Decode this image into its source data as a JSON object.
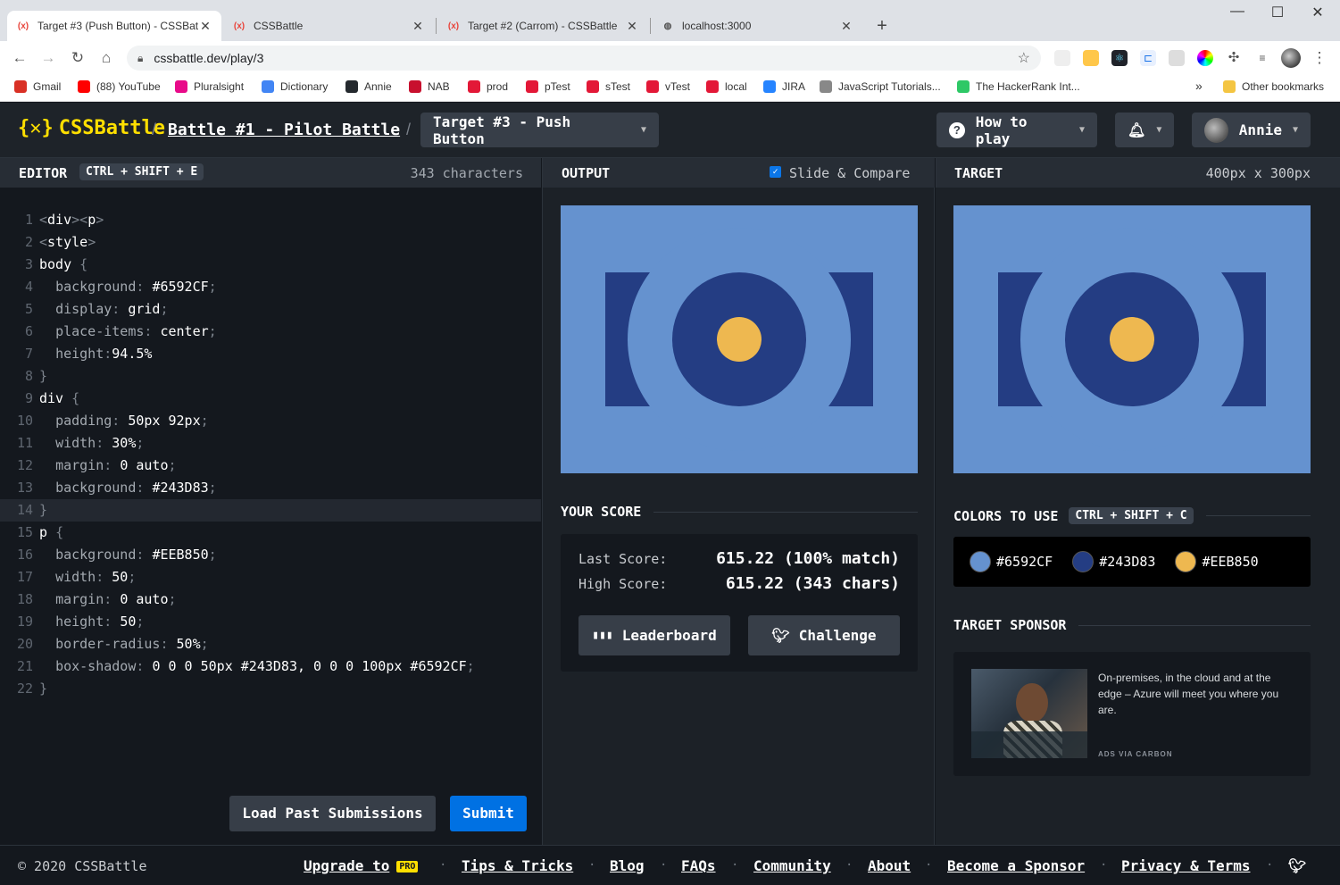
{
  "browser": {
    "tabs": [
      {
        "title": "Target #3 (Push Button) - CSSBat",
        "favicon": "cssbattle-favicon",
        "active": true
      },
      {
        "title": "CSSBattle",
        "favicon": "cssbattle-favicon",
        "active": false
      },
      {
        "title": "Target #2 (Carrom) - CSSBattle",
        "favicon": "cssbattle-favicon",
        "active": false
      },
      {
        "title": "localhost:3000",
        "favicon": "globe-icon",
        "active": false
      }
    ],
    "url": "cssbattle.dev/play/3",
    "bookmarks": [
      {
        "label": "Gmail",
        "color": "#d93025"
      },
      {
        "label": "(88) YouTube",
        "color": "#ff0000"
      },
      {
        "label": "Pluralsight",
        "color": "#e80a89"
      },
      {
        "label": "Dictionary",
        "color": "#4285f4"
      },
      {
        "label": "Annie",
        "color": "#24292e"
      },
      {
        "label": "NAB",
        "color": "#c8102e"
      },
      {
        "label": "prod",
        "color": "#e31837"
      },
      {
        "label": "pTest",
        "color": "#e31837"
      },
      {
        "label": "sTest",
        "color": "#e31837"
      },
      {
        "label": "vTest",
        "color": "#e31837"
      },
      {
        "label": "local",
        "color": "#e31837"
      },
      {
        "label": "JIRA",
        "color": "#2684ff"
      },
      {
        "label": "JavaScript Tutorials...",
        "color": "#888888"
      },
      {
        "label": "The HackerRank Int...",
        "color": "#2ec866"
      }
    ],
    "more_bookmarks": "»",
    "other_bookmarks": "Other bookmarks"
  },
  "header": {
    "logo_text": "CSSBattle",
    "battle_link": "Battle #1 - Pilot Battle",
    "target_select": "Target #3 - Push Button",
    "how_to_play": "How to play",
    "user_name": "Annie"
  },
  "editor": {
    "label": "EDITOR",
    "shortcut": "CTRL + SHIFT + E",
    "char_count": "343 characters",
    "lines": [
      "<div><p>",
      "<style>",
      "body {",
      "  background: #6592CF;",
      "  display: grid;",
      "  place-items: center;",
      "  height:94.5%",
      "}",
      "div {",
      "  padding: 50px 92px;",
      "  width: 30%;",
      "  margin: 0 auto;",
      "  background: #243D83;",
      "}",
      "p {",
      "  background: #EEB850;",
      "  width: 50;",
      "  margin: 0 auto;",
      "  height: 50;",
      "  border-radius: 50%;",
      "  box-shadow: 0 0 0 50px #243D83, 0 0 0 100px #6592CF;",
      "}"
    ],
    "load_past_label": "Load Past Submissions",
    "submit_label": "Submit"
  },
  "output": {
    "label": "OUTPUT",
    "slide_compare_label": "Slide & Compare",
    "slide_compare_checked": true,
    "score_title": "YOUR SCORE",
    "last_score_label": "Last Score:",
    "last_score_value": "615.22 (100% match)",
    "high_score_label": "High Score:",
    "high_score_value": "615.22 (343 chars)",
    "leaderboard_label": "Leaderboard",
    "challenge_label": "Challenge"
  },
  "target": {
    "label": "TARGET",
    "dimensions": "400px x 300px",
    "colors_title": "COLORS TO USE",
    "colors_shortcut": "CTRL + SHIFT + C",
    "colors": [
      "#6592CF",
      "#243D83",
      "#EEB850"
    ],
    "sponsor_title": "TARGET SPONSOR",
    "sponsor_text": "On-premises, in the cloud and at the edge – Azure will meet you where you are.",
    "sponsor_via": "ADS VIA CARBON"
  },
  "footer": {
    "copyright": "© 2020 CSSBattle",
    "upgrade_label": "Upgrade to",
    "pro_badge": "PRO",
    "links": [
      "Tips & Tricks",
      "Blog",
      "FAQs",
      "Community",
      "About",
      "Become a Sponsor",
      "Privacy & Terms"
    ]
  },
  "theme": {
    "accent": "#ffdf00",
    "submit_blue": "#0071e3"
  }
}
